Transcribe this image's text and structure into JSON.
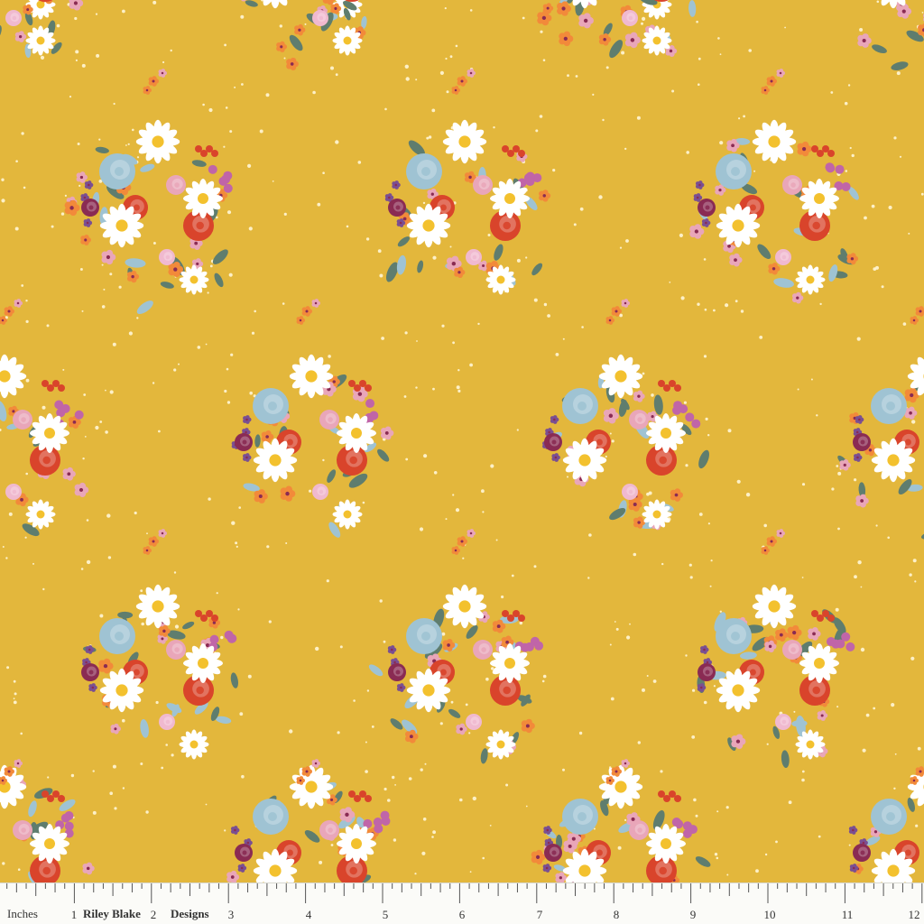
{
  "colors": {
    "background": "#e3b73c",
    "dot": "#fff6d6",
    "ruler": "#fbfbf8",
    "flowers": [
      "#ffffff",
      "#9fc3d3",
      "#d9442b",
      "#e9a6b9",
      "#f28a3a",
      "#8a2b53",
      "#7a4f92",
      "#5f7d6e"
    ]
  },
  "ruler": {
    "unit_label": "Inches",
    "brand_label_1": "Riley Blake",
    "brand_label_2": "Designs",
    "numbers": [
      "1",
      "2",
      "3",
      "4",
      "5",
      "6",
      "7",
      "8",
      "9",
      "10",
      "11",
      "12"
    ]
  }
}
